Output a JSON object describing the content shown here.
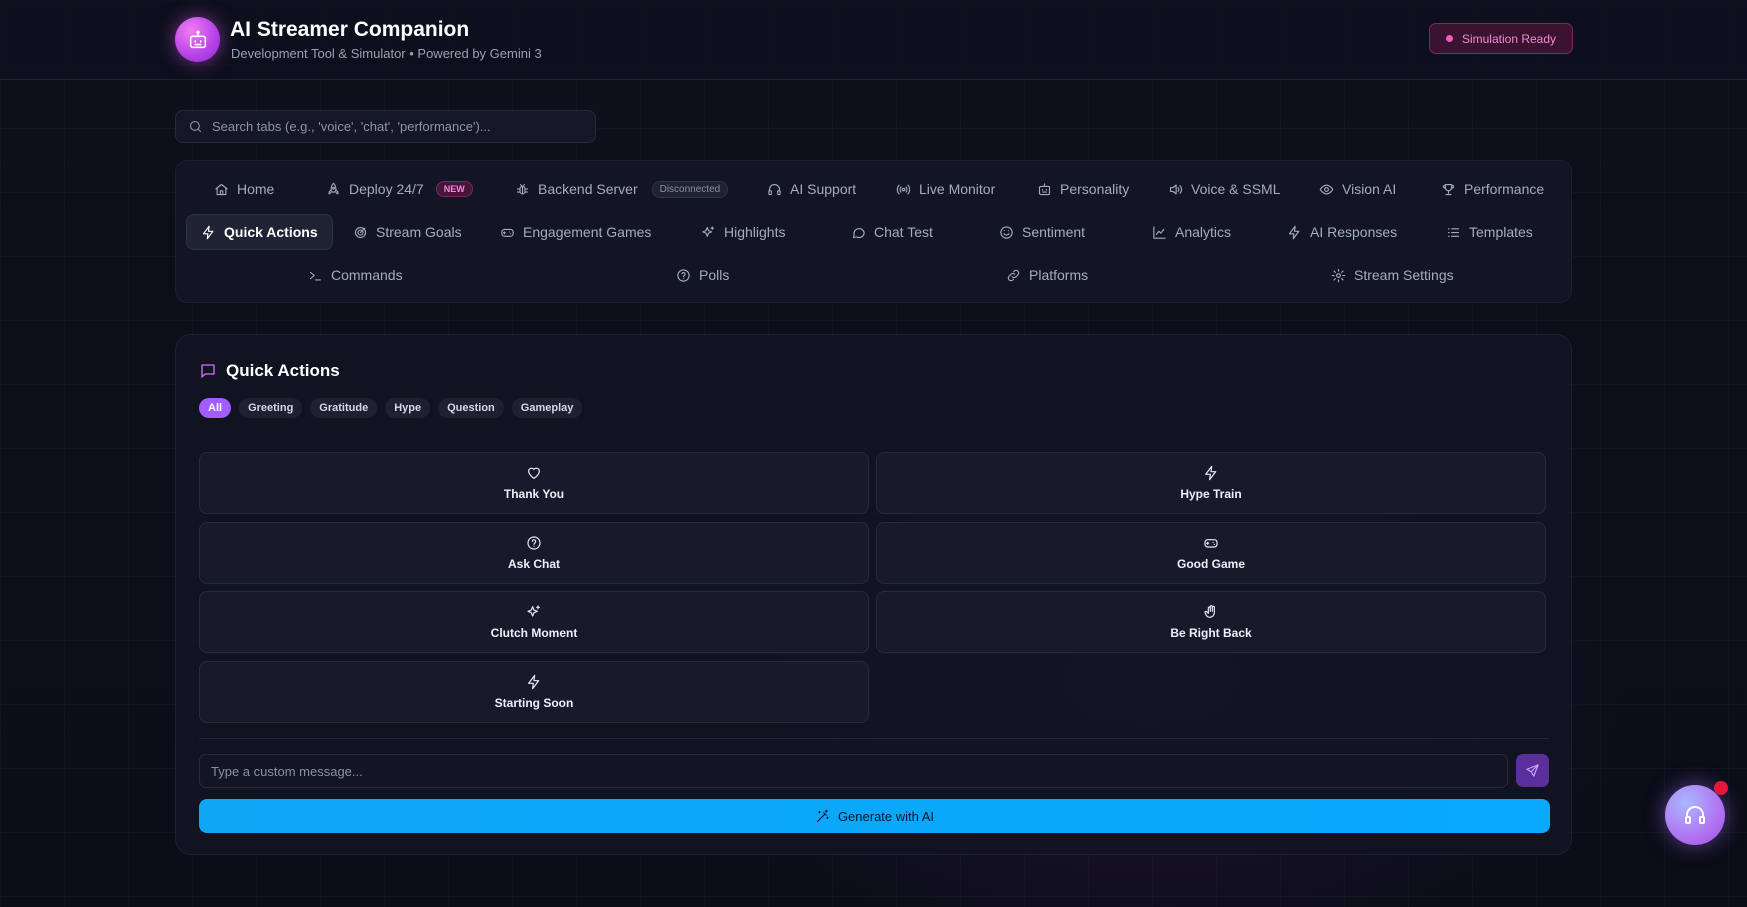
{
  "header": {
    "title": "AI Streamer Companion",
    "subtitle": "Development Tool & Simulator • Powered by Gemini 3",
    "status": "Simulation Ready"
  },
  "search": {
    "placeholder": "Search tabs (e.g., 'voice', 'chat', 'performance')..."
  },
  "tabs": {
    "home": "Home",
    "deploy": "Deploy 24/7",
    "deploy_badge": "NEW",
    "backend": "Backend Server",
    "backend_badge": "Disconnected",
    "ai_support": "AI Support",
    "live_monitor": "Live Monitor",
    "personality": "Personality",
    "voice": "Voice & SSML",
    "vision": "Vision AI",
    "performance": "Performance",
    "quick_actions": "Quick Actions",
    "stream_goals": "Stream Goals",
    "engagement_games": "Engagement Games",
    "highlights": "Highlights",
    "chat_test": "Chat Test",
    "sentiment": "Sentiment",
    "analytics": "Analytics",
    "ai_responses": "AI Responses",
    "templates": "Templates",
    "commands": "Commands",
    "polls": "Polls",
    "platforms": "Platforms",
    "stream_settings": "Stream Settings"
  },
  "panel": {
    "title": "Quick Actions",
    "filters": [
      "All",
      "Greeting",
      "Gratitude",
      "Hype",
      "Question",
      "Gameplay"
    ],
    "active_filter": "All",
    "actions": [
      {
        "label": "Thank You",
        "icon": "heart-icon"
      },
      {
        "label": "Hype Train",
        "icon": "zap-icon"
      },
      {
        "label": "Ask Chat",
        "icon": "question-circle-icon"
      },
      {
        "label": "Good Game",
        "icon": "gamepad-icon"
      },
      {
        "label": "Clutch Moment",
        "icon": "sparkles-icon"
      },
      {
        "label": "Be Right Back",
        "icon": "hand-icon"
      },
      {
        "label": "Starting Soon",
        "icon": "zap-icon"
      }
    ],
    "message_placeholder": "Type a custom message...",
    "generate_label": "Generate with AI"
  },
  "colors": {
    "accent_purple": "#a35cff",
    "accent_blue": "#0ea5f5",
    "status_pink": "#f45bb8",
    "background": "#0d0f1b"
  }
}
